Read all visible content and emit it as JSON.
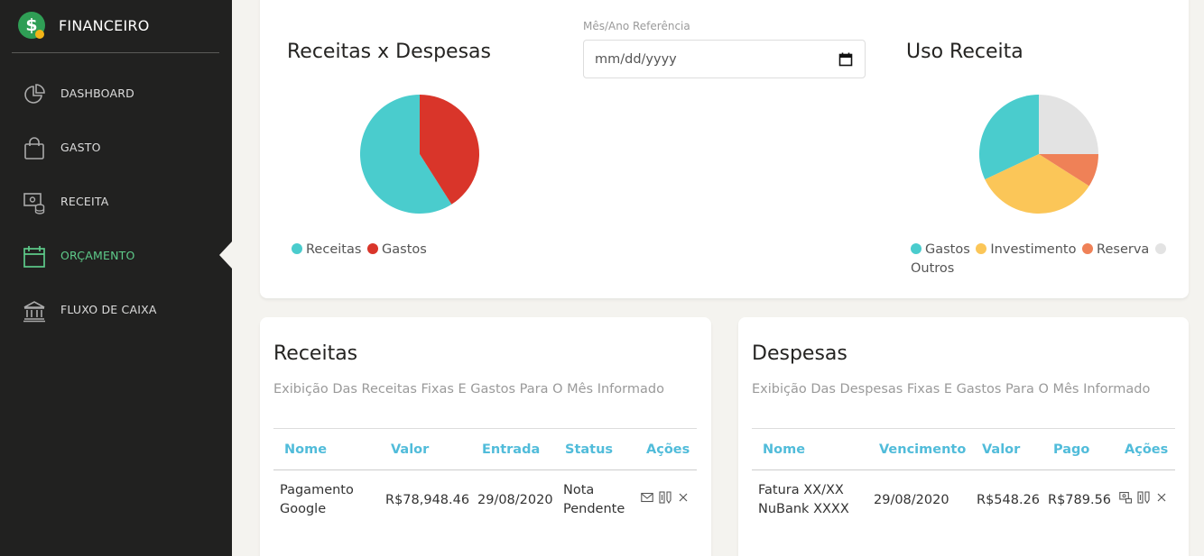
{
  "brand": {
    "name": "FINANCEIRO",
    "logo_symbol": "$",
    "colors": {
      "logo": "#2f9e55",
      "coin": "#f2b417"
    }
  },
  "sidebar": {
    "items": [
      {
        "label": "DASHBOARD",
        "icon": "pie-chart-icon"
      },
      {
        "label": "GASTO",
        "icon": "shopping-bag-icon"
      },
      {
        "label": "RECEITA",
        "icon": "money-icon"
      },
      {
        "label": "ORÇAMENTO",
        "icon": "calendar-icon",
        "active": true
      },
      {
        "label": "FLUXO DE CAIXA",
        "icon": "bank-icon"
      }
    ],
    "active_color": "#5ecb8a"
  },
  "top": {
    "date_label": "Mês/Ano Referência",
    "date_placeholder": "mm/dd/yyyy"
  },
  "chart_data": [
    {
      "type": "pie",
      "title": "Receitas x Despesas",
      "labels": [
        "Receitas",
        "Gastos"
      ],
      "values": [
        59,
        41
      ],
      "colors": [
        "#4acccd",
        "#d9352a"
      ],
      "legend": "bottom-left"
    },
    {
      "type": "pie",
      "title": "Uso Receita",
      "labels": [
        "Gastos",
        "Investimento",
        "Reserva",
        "Outros"
      ],
      "values": [
        32,
        34,
        9,
        25
      ],
      "colors": [
        "#4acccd",
        "#fbc658",
        "#ef8157",
        "#e3e3e3"
      ],
      "legend": "bottom"
    }
  ],
  "receitas": {
    "title": "Receitas",
    "subtitle": "Exibição Das Receitas Fixas E Gastos Para O Mês Informado",
    "columns": [
      "Nome",
      "Valor",
      "Entrada",
      "Status",
      "Ações"
    ],
    "rows": [
      {
        "nome_1": "Pagamento",
        "nome_2": "Google",
        "valor": "R$78,948.46",
        "entrada": "29/08/2020",
        "status_1": "Nota",
        "status_2": "Pendente"
      }
    ]
  },
  "despesas": {
    "title": "Despesas",
    "subtitle": "Exibição Das Despesas Fixas E Gastos Para O Mês Informado",
    "columns": [
      "Nome",
      "Vencimento",
      "Valor",
      "Pago",
      "Ações"
    ],
    "rows": [
      {
        "nome_1": "Fatura XX/XX",
        "nome_2": "NuBank XXXX",
        "vencimento": "29/08/2020",
        "valor": "R$548.26",
        "pago": "R$789.56"
      }
    ]
  },
  "accent_color": "#51bcda"
}
